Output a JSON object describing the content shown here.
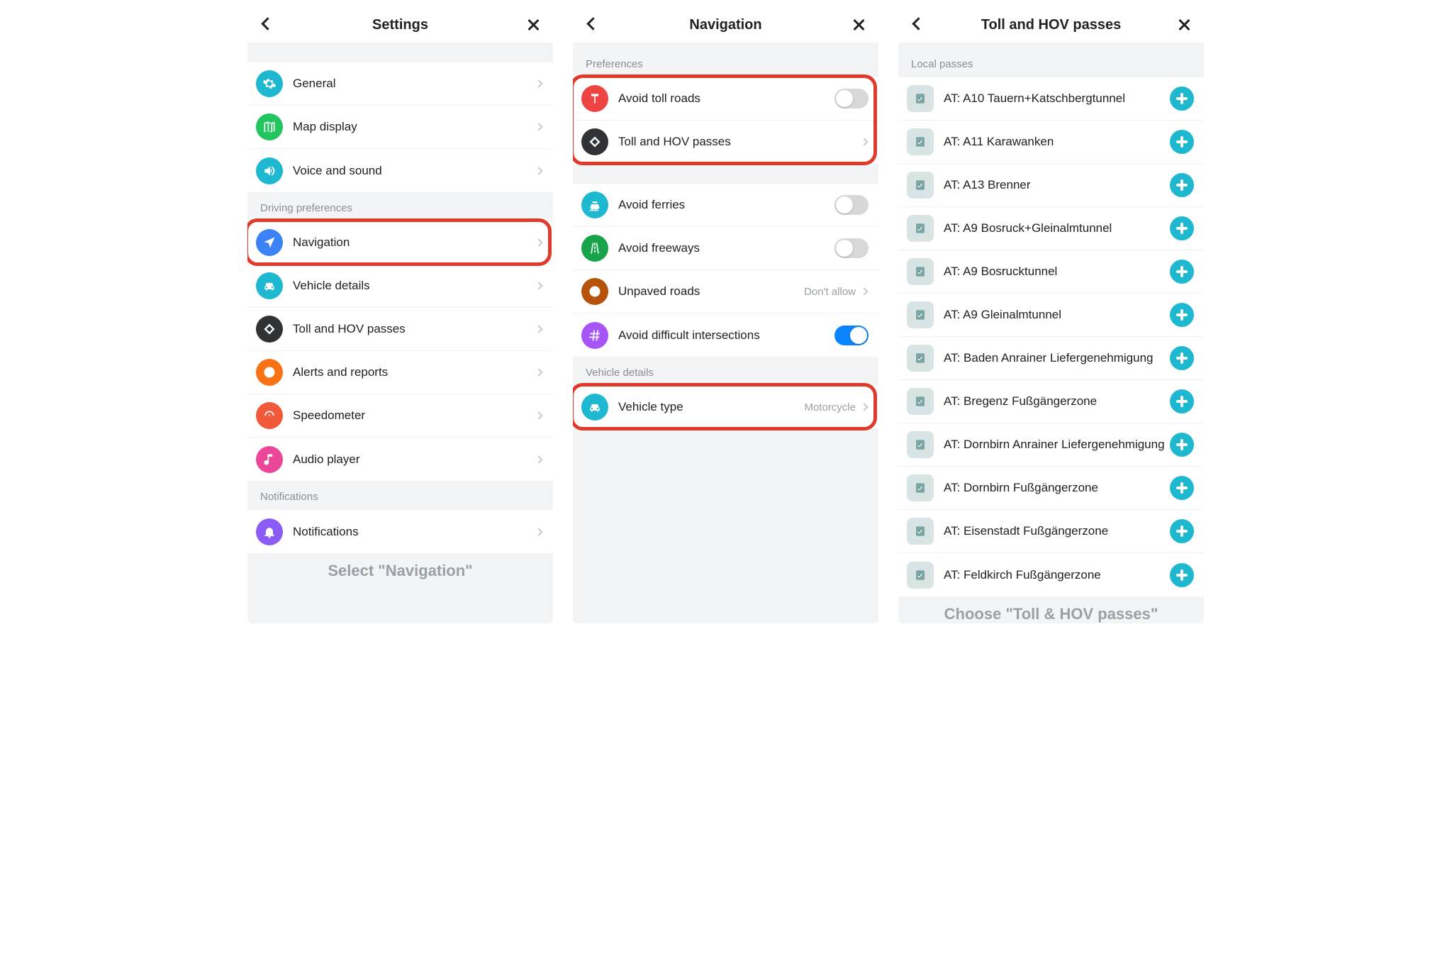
{
  "screens": {
    "settings": {
      "title": "Settings",
      "caption": "Select \"Navigation\"",
      "group_driving": "Driving preferences",
      "group_notifications": "Notifications",
      "items": {
        "general": {
          "label": "General"
        },
        "map": {
          "label": "Map display"
        },
        "voice": {
          "label": "Voice and sound"
        },
        "navigation": {
          "label": "Navigation"
        },
        "vehicle": {
          "label": "Vehicle details"
        },
        "toll": {
          "label": "Toll and HOV passes"
        },
        "alerts": {
          "label": "Alerts and reports"
        },
        "speedo": {
          "label": "Speedometer"
        },
        "audio": {
          "label": "Audio player"
        },
        "notifications": {
          "label": "Notifications"
        }
      }
    },
    "navigation": {
      "title": "Navigation",
      "group_prefs": "Preferences",
      "group_vehicle": "Vehicle details",
      "items": {
        "avoid_toll": {
          "label": "Avoid toll roads",
          "toggle": false
        },
        "toll_hov": {
          "label": "Toll and HOV passes"
        },
        "avoid_ferries": {
          "label": "Avoid ferries",
          "toggle": false
        },
        "avoid_freeways": {
          "label": "Avoid freeways",
          "toggle": false
        },
        "unpaved": {
          "label": "Unpaved roads",
          "value": "Don't allow"
        },
        "intersect": {
          "label": "Avoid difficult intersections",
          "toggle": true
        },
        "vehicle_type": {
          "label": "Vehicle type",
          "value": "Motorcycle"
        }
      }
    },
    "passes": {
      "title": "Toll and HOV passes",
      "caption": "Choose \"Toll & HOV passes\"",
      "group_local": "Local passes",
      "items": [
        {
          "label": "AT: A10 Tauern+Katschbergtunnel"
        },
        {
          "label": "AT: A11 Karawanken"
        },
        {
          "label": "AT: A13 Brenner"
        },
        {
          "label": "AT: A9 Bosruck+Gleinalmtunnel"
        },
        {
          "label": "AT: A9 Bosrucktunnel"
        },
        {
          "label": "AT: A9 Gleinalmtunnel"
        },
        {
          "label": "AT: Baden Anrainer Liefergenehmigung"
        },
        {
          "label": "AT: Bregenz Fußgängerzone"
        },
        {
          "label": "AT: Dornbirn Anrainer Liefergenehmigung"
        },
        {
          "label": "AT: Dornbirn Fußgängerzone"
        },
        {
          "label": "AT: Eisenstadt Fußgängerzone"
        },
        {
          "label": "AT: Feldkirch Fußgängerzone"
        }
      ]
    }
  }
}
